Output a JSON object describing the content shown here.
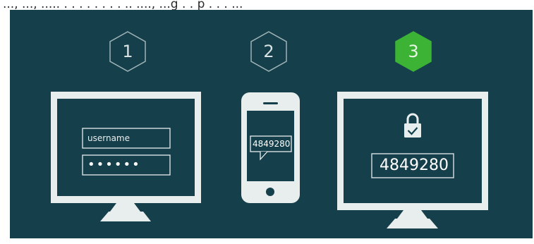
{
  "header": {
    "text": "..., ..., ..... . . . . . . . . .. ...., ...g . . p . . . ..."
  },
  "steps": [
    {
      "number": "1"
    },
    {
      "number": "2"
    },
    {
      "number": "3",
      "active": true
    }
  ],
  "login": {
    "username_placeholder": "username",
    "password_mask": "••••••"
  },
  "phone": {
    "code": "4849280"
  },
  "verify": {
    "code": "4849280"
  },
  "colors": {
    "panel": "#153f4a",
    "line": "#e8eeee",
    "active_hex": "#3db336"
  }
}
